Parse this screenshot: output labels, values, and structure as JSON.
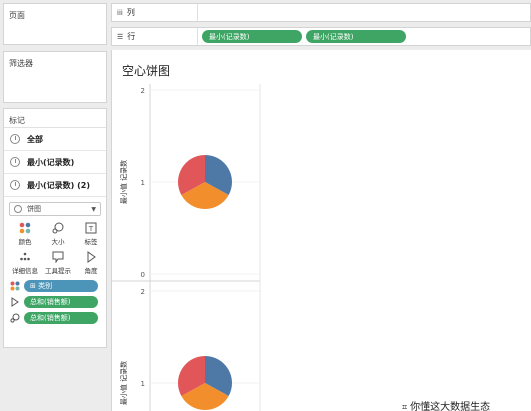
{
  "left": {
    "pages_title": "页面",
    "filters_title": "筛选器",
    "marks_title": "标记",
    "mark_rows": [
      {
        "label": "全部"
      },
      {
        "label": "最小(记录数)"
      },
      {
        "label": "最小(记录数) (2)"
      }
    ],
    "mark_type": "饼图",
    "mark_buttons": [
      "颜色",
      "大小",
      "标签",
      "详细信息",
      "工具提示",
      "角度"
    ],
    "mark_pills": [
      {
        "label": "类别",
        "prefix": "⊞",
        "color": "blue"
      },
      {
        "label": "总和(销售额)",
        "color": "green"
      },
      {
        "label": "总和(销售额)",
        "color": "green"
      }
    ]
  },
  "shelves": {
    "columns_label": "列",
    "rows_label": "行",
    "row_pills": [
      "最小(记录数)",
      "最小(记录数)"
    ]
  },
  "sheet": {
    "title": "空心饼图"
  },
  "chart_data": {
    "type": "pie",
    "panes": [
      {
        "ylabel": "最小值 记录数",
        "yticks": [
          "2",
          "1",
          "0"
        ],
        "ylim": [
          0,
          2
        ],
        "value": 1
      },
      {
        "ylabel": "最小值 记录数",
        "yticks": [
          "2",
          "1"
        ],
        "ylim": [
          0,
          2
        ],
        "value": 1
      }
    ],
    "slices": [
      {
        "share": 0.33,
        "color": "#4e79a7"
      },
      {
        "share": 0.34,
        "color": "#f28e2b"
      },
      {
        "share": 0.33,
        "color": "#e15759"
      }
    ]
  },
  "watermark": "你懂这大数据生态"
}
